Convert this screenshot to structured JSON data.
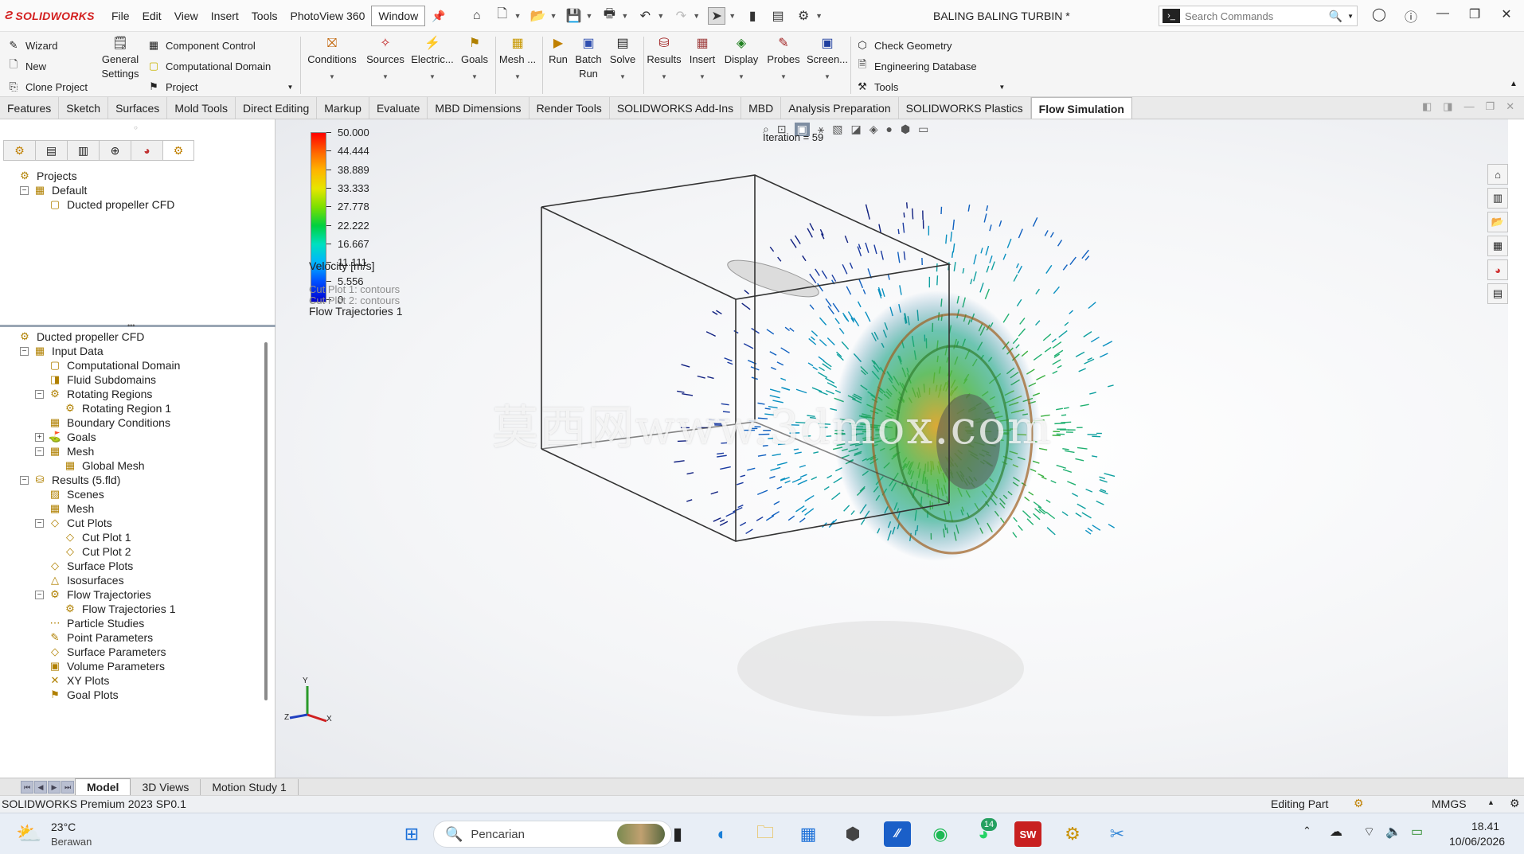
{
  "app": {
    "logo": "SOLIDWORKS",
    "document_title": "BALING BALING TURBIN *",
    "menu": [
      "File",
      "Edit",
      "View",
      "Insert",
      "Tools",
      "PhotoView 360",
      "Window"
    ],
    "search_placeholder": "Search Commands"
  },
  "ribbon": {
    "left_col": [
      "Wizard",
      "New",
      "Clone Project"
    ],
    "general_settings": "General Settings",
    "mid_col": [
      "Component Control",
      "Computational Domain",
      "Project"
    ],
    "buttons": [
      "Conditions",
      "Sources",
      "Electric...",
      "Goals",
      "Mesh ...",
      "Run",
      "Batch Run",
      "Solve",
      "Results",
      "Insert",
      "Display",
      "Probes",
      "Screen..."
    ],
    "right_col": [
      "Check Geometry",
      "Engineering Database",
      "Tools"
    ]
  },
  "tabs": [
    "Features",
    "Sketch",
    "Surfaces",
    "Mold Tools",
    "Direct Editing",
    "Markup",
    "Evaluate",
    "MBD Dimensions",
    "Render Tools",
    "SOLIDWORKS Add-Ins",
    "MBD",
    "Analysis Preparation",
    "SOLIDWORKS Plastics",
    "Flow Simulation"
  ],
  "active_tab": "Flow Simulation",
  "projects_tree": [
    {
      "label": "Projects",
      "depth": 0,
      "toggle": ""
    },
    {
      "label": "Default",
      "depth": 1,
      "toggle": "−"
    },
    {
      "label": "Ducted propeller CFD",
      "depth": 2,
      "toggle": ""
    }
  ],
  "analysis_tree": [
    {
      "label": "Ducted propeller CFD",
      "depth": 0,
      "toggle": ""
    },
    {
      "label": "Input Data",
      "depth": 1,
      "toggle": "−"
    },
    {
      "label": "Computational Domain",
      "depth": 2,
      "toggle": ""
    },
    {
      "label": "Fluid Subdomains",
      "depth": 2,
      "toggle": ""
    },
    {
      "label": "Rotating Regions",
      "depth": 2,
      "toggle": "−"
    },
    {
      "label": "Rotating Region 1",
      "depth": 3,
      "toggle": ""
    },
    {
      "label": "Boundary Conditions",
      "depth": 2,
      "toggle": ""
    },
    {
      "label": "Goals",
      "depth": 2,
      "toggle": "+"
    },
    {
      "label": "Mesh",
      "depth": 2,
      "toggle": "−"
    },
    {
      "label": "Global Mesh",
      "depth": 3,
      "toggle": ""
    },
    {
      "label": "Results (5.fld)",
      "depth": 1,
      "toggle": "−"
    },
    {
      "label": "Scenes",
      "depth": 2,
      "toggle": ""
    },
    {
      "label": "Mesh",
      "depth": 2,
      "toggle": ""
    },
    {
      "label": "Cut Plots",
      "depth": 2,
      "toggle": "−"
    },
    {
      "label": "Cut Plot 1",
      "depth": 3,
      "toggle": ""
    },
    {
      "label": "Cut Plot 2",
      "depth": 3,
      "toggle": ""
    },
    {
      "label": "Surface Plots",
      "depth": 2,
      "toggle": ""
    },
    {
      "label": "Isosurfaces",
      "depth": 2,
      "toggle": ""
    },
    {
      "label": "Flow Trajectories",
      "depth": 2,
      "toggle": "−"
    },
    {
      "label": "Flow Trajectories 1",
      "depth": 3,
      "toggle": ""
    },
    {
      "label": "Particle Studies",
      "depth": 2,
      "toggle": ""
    },
    {
      "label": "Point Parameters",
      "depth": 2,
      "toggle": ""
    },
    {
      "label": "Surface Parameters",
      "depth": 2,
      "toggle": ""
    },
    {
      "label": "Volume Parameters",
      "depth": 2,
      "toggle": ""
    },
    {
      "label": "XY Plots",
      "depth": 2,
      "toggle": ""
    },
    {
      "label": "Goal Plots",
      "depth": 2,
      "toggle": ""
    }
  ],
  "viewport": {
    "iteration": "Iteration = 59",
    "legend_values": [
      "50.000",
      "44.444",
      "38.889",
      "33.333",
      "27.778",
      "22.222",
      "16.667",
      "11.111",
      "5.556",
      "0"
    ],
    "legend_title": "Velocity [m/s]",
    "plots": [
      "Cut Plot 1: contours",
      "Cut Plot 2: contours"
    ],
    "trajectories": "Flow Trajectories 1",
    "watermark": "莫西网www.3dmox.com",
    "triad": [
      "Y",
      "Z",
      "X"
    ]
  },
  "bottom_tabs": [
    "Model",
    "3D Views",
    "Motion Study 1"
  ],
  "status": {
    "product": "SOLIDWORKS Premium 2023 SP0.1",
    "mode": "Editing Part",
    "units": "MMGS"
  },
  "taskbar": {
    "weather_temp": "23°C",
    "weather_desc": "Berawan",
    "search": "Pencarian",
    "whatsapp_badge": "14",
    "time": "18.41",
    "date": "10/06/2026"
  },
  "colors": {
    "accent_red": "#d32020",
    "ribbon_bg": "#f5f5f5"
  }
}
